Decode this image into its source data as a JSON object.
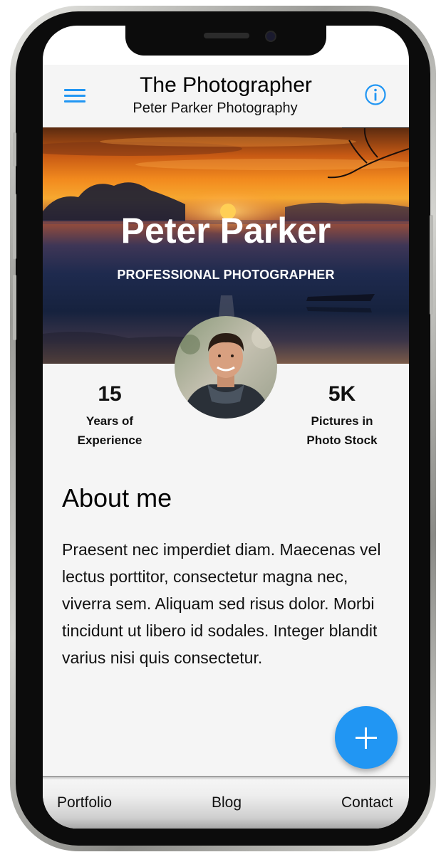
{
  "header": {
    "title": "The Photographer",
    "subtitle": "Peter Parker Photography",
    "menu_icon": "hamburger-menu-icon",
    "info_icon": "info-circle-icon"
  },
  "hero": {
    "name": "Peter Parker",
    "role": "PROFESSIONAL PHOTOGRAPHER"
  },
  "stats": [
    {
      "value": "15",
      "label_line1": "Years of",
      "label_line2": "Experience"
    },
    {
      "value": "5K",
      "label_line1": "Pictures in",
      "label_line2": "Photo Stock"
    }
  ],
  "about": {
    "title": "About me",
    "text": "Praesent nec imperdiet diam. Maecenas vel lectus porttitor, consectetur magna nec, viverra sem. Aliquam sed risus dolor. Morbi tincidunt ut libero id sodales. Integer blandit varius nisi quis consectetur."
  },
  "fab": {
    "icon": "plus-icon"
  },
  "bottom_nav": [
    "Portfolio",
    "Blog",
    "Contact"
  ],
  "colors": {
    "accent": "#2196f3",
    "background": "#f5f5f5"
  }
}
